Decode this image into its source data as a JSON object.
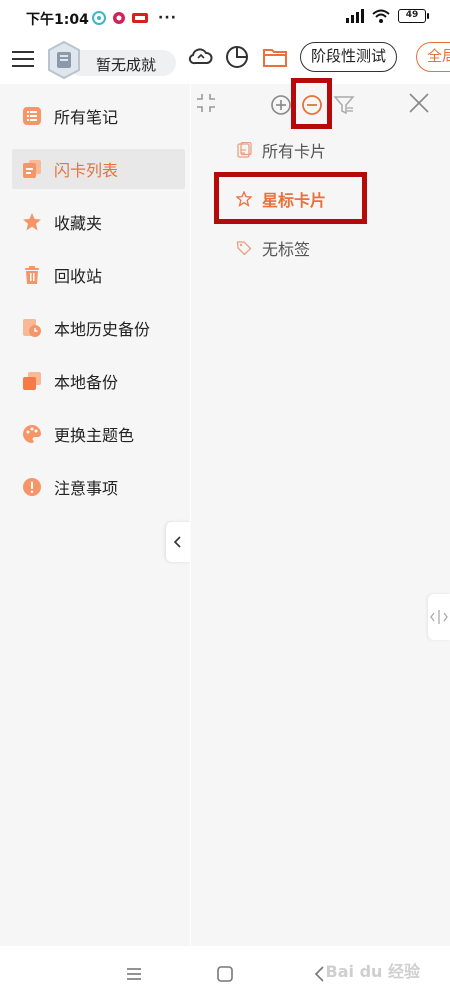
{
  "status_bar": {
    "time": "下午1:04",
    "more": "···",
    "battery": "49"
  },
  "toolbar": {
    "achievement_label": "暂无成就",
    "stage_test_label": "阶段性测试",
    "full_label": "全局"
  },
  "sidebar": {
    "items": [
      {
        "label": "所有笔记",
        "icon": "list-icon"
      },
      {
        "label": "闪卡列表",
        "icon": "cards-icon",
        "active": true
      },
      {
        "label": "收藏夹",
        "icon": "star-icon"
      },
      {
        "label": "回收站",
        "icon": "trash-icon"
      },
      {
        "label": "本地历史备份",
        "icon": "history-icon"
      },
      {
        "label": "本地备份",
        "icon": "backup-icon"
      },
      {
        "label": "更换主题色",
        "icon": "palette-icon"
      },
      {
        "label": "注意事项",
        "icon": "warning-icon"
      }
    ]
  },
  "panel": {
    "tags": [
      {
        "label": "所有卡片",
        "icon": "note-icon"
      },
      {
        "label": "星标卡片",
        "icon": "star-outline-icon"
      },
      {
        "label": "无标签",
        "icon": "tag-icon"
      }
    ]
  },
  "watermark": "Bai du 经验",
  "colors": {
    "accent": "#e8713c",
    "highlight": "#b50a0a",
    "sidebar_bg": "#f6f6f6"
  }
}
